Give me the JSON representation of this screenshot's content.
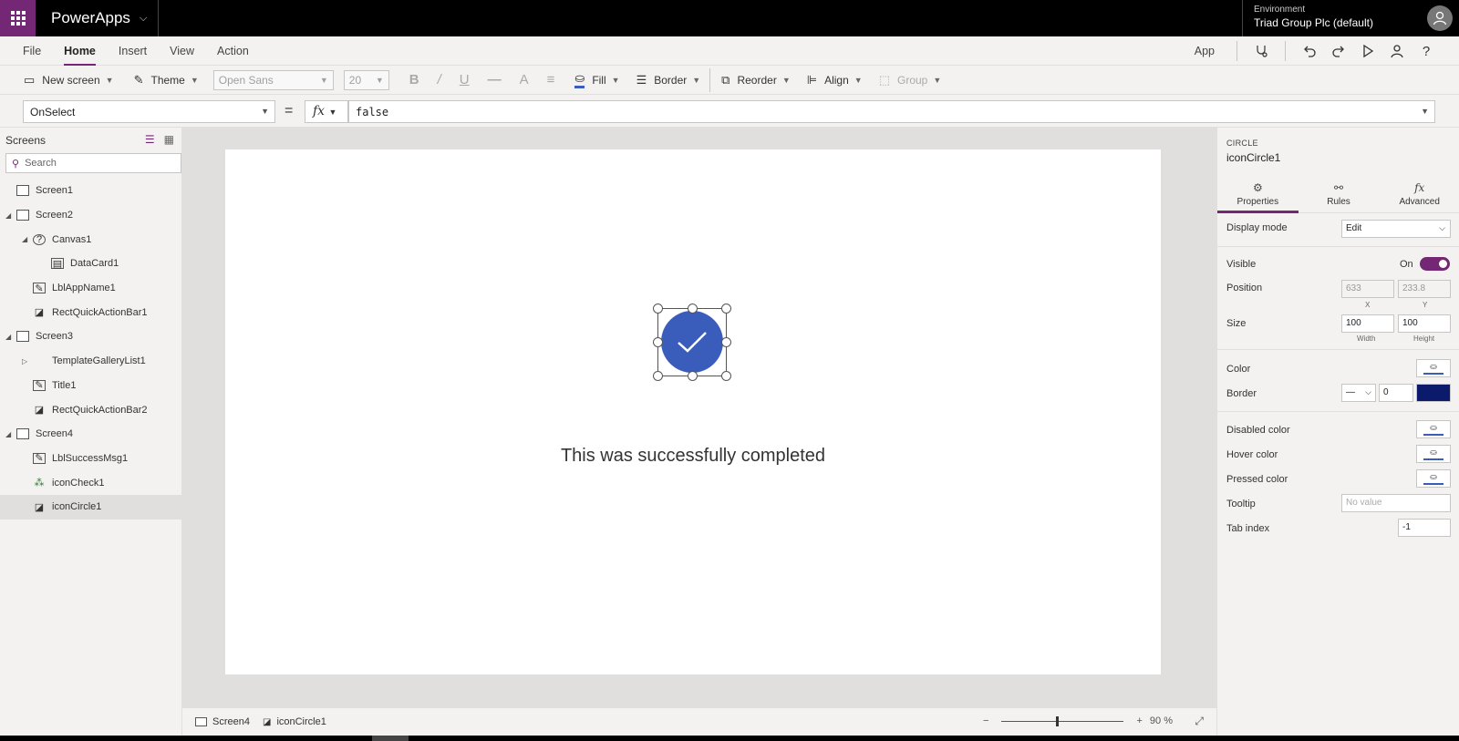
{
  "topbar": {
    "app_name": "PowerApps",
    "environment_label": "Environment",
    "environment_value": "Triad Group Plc (default)"
  },
  "menu": {
    "items": [
      "File",
      "Home",
      "Insert",
      "View",
      "Action"
    ],
    "active": "Home",
    "app_label": "App"
  },
  "toolbar": {
    "new_screen": "New screen",
    "theme": "Theme",
    "font": "Open Sans",
    "font_size": "20",
    "fill": "Fill",
    "border": "Border",
    "reorder": "Reorder",
    "align": "Align",
    "group": "Group"
  },
  "formula_bar": {
    "property": "OnSelect",
    "equals": "=",
    "fx": "fx",
    "formula": "false"
  },
  "left_panel": {
    "title": "Screens",
    "search_placeholder": "Search",
    "tree": [
      {
        "label": "Screen1",
        "icon": "screen-icon",
        "level": 0,
        "caret": ""
      },
      {
        "label": "Screen2",
        "icon": "screen-icon",
        "level": 0,
        "caret": "expanded"
      },
      {
        "label": "Canvas1",
        "icon": "canvas-icon",
        "level": 1,
        "caret": "expanded"
      },
      {
        "label": "DataCard1",
        "icon": "datacard-icon",
        "level": 2,
        "caret": ""
      },
      {
        "label": "LblAppName1",
        "icon": "label-icon",
        "level": 1,
        "caret": ""
      },
      {
        "label": "RectQuickActionBar1",
        "icon": "shape-icon",
        "level": 1,
        "caret": ""
      },
      {
        "label": "Screen3",
        "icon": "screen-icon",
        "level": 0,
        "caret": "expanded"
      },
      {
        "label": "TemplateGalleryList1",
        "icon": "gallery-icon",
        "level": 1,
        "caret": "collapsed"
      },
      {
        "label": "Title1",
        "icon": "label-icon",
        "level": 1,
        "caret": ""
      },
      {
        "label": "RectQuickActionBar2",
        "icon": "shape-icon",
        "level": 1,
        "caret": ""
      },
      {
        "label": "Screen4",
        "icon": "screen-icon",
        "level": 0,
        "caret": "expanded"
      },
      {
        "label": "LblSuccessMsg1",
        "icon": "label-icon",
        "level": 1,
        "caret": ""
      },
      {
        "label": "iconCheck1",
        "icon": "icons-icon",
        "level": 1,
        "caret": ""
      },
      {
        "label": "iconCircle1",
        "icon": "shape-icon",
        "level": 1,
        "caret": "",
        "selected": true
      }
    ]
  },
  "canvas": {
    "message": "This was successfully completed",
    "circle_color": "#3a5dbb"
  },
  "status_bar": {
    "screen": "Screen4",
    "control": "iconCircle1",
    "zoom_minus": "−",
    "zoom_plus": "+",
    "zoom_value": "90 %"
  },
  "right_panel": {
    "type": "CIRCLE",
    "name": "iconCircle1",
    "tabs": [
      "Properties",
      "Rules",
      "Advanced"
    ],
    "active_tab": "Properties",
    "display_mode_label": "Display mode",
    "display_mode_value": "Edit",
    "visible_label": "Visible",
    "visible_value": "On",
    "position_label": "Position",
    "position_x": "633",
    "position_y": "233.8",
    "x_caption": "X",
    "y_caption": "Y",
    "size_label": "Size",
    "width_value": "100",
    "height_value": "100",
    "width_caption": "Width",
    "height_caption": "Height",
    "color_label": "Color",
    "border_label": "Border",
    "border_width": "0",
    "border_color": "#0b1a6b",
    "disabled_color_label": "Disabled color",
    "hover_color_label": "Hover color",
    "pressed_color_label": "Pressed color",
    "tooltip_label": "Tooltip",
    "tooltip_placeholder": "No value",
    "tab_index_label": "Tab index",
    "tab_index_value": "-1"
  },
  "colors": {
    "accent": "#742774",
    "circle_blue": "#3a5dbb"
  }
}
